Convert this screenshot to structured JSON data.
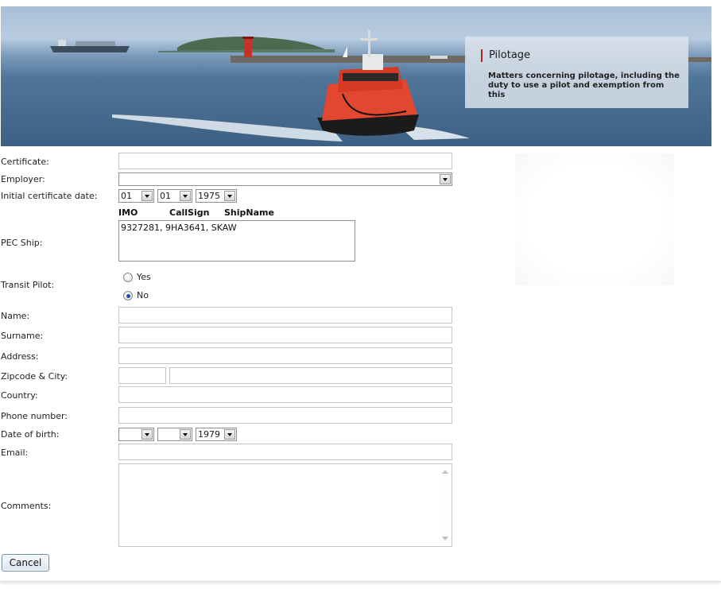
{
  "banner": {
    "title": "Pilotage",
    "description": "Matters concerning pilotage, including the duty to use a pilot and exemption from this"
  },
  "form": {
    "certificate": {
      "label": "Certificate:",
      "value": ""
    },
    "employer": {
      "label": "Employer:",
      "value": ""
    },
    "initial_date": {
      "label": "Initial certificate date:",
      "day": "01",
      "month": "01",
      "year": "1975"
    },
    "pec_ship": {
      "label": "PEC Ship:",
      "columns": [
        "IMO",
        "CallSign",
        "ShipName"
      ],
      "items": [
        "9327281, 9HA3641, SKAW"
      ]
    },
    "transit_pilot": {
      "label": "Transit Pilot:",
      "options": [
        {
          "label": "Yes",
          "selected": false
        },
        {
          "label": "No",
          "selected": true
        }
      ]
    },
    "name": {
      "label": "Name:",
      "value": ""
    },
    "surname": {
      "label": "Surname:",
      "value": ""
    },
    "address": {
      "label": "Address:",
      "value": ""
    },
    "zipcode_city": {
      "label": "Zipcode & City:",
      "zipcode": "",
      "city": ""
    },
    "country": {
      "label": "Country:",
      "value": ""
    },
    "phone": {
      "label": "Phone number:",
      "value": ""
    },
    "dob": {
      "label": "Date of birth:",
      "day": "",
      "month": "",
      "year": "1979"
    },
    "email": {
      "label": "Email:",
      "value": ""
    },
    "comments": {
      "label": "Comments:",
      "value": ""
    }
  },
  "actions": {
    "cancel_label": "Cancel"
  },
  "colors": {
    "accent_bar": "#b22222",
    "radio_selected": "#1f4fa5",
    "button_border": "#6b8bb2"
  }
}
